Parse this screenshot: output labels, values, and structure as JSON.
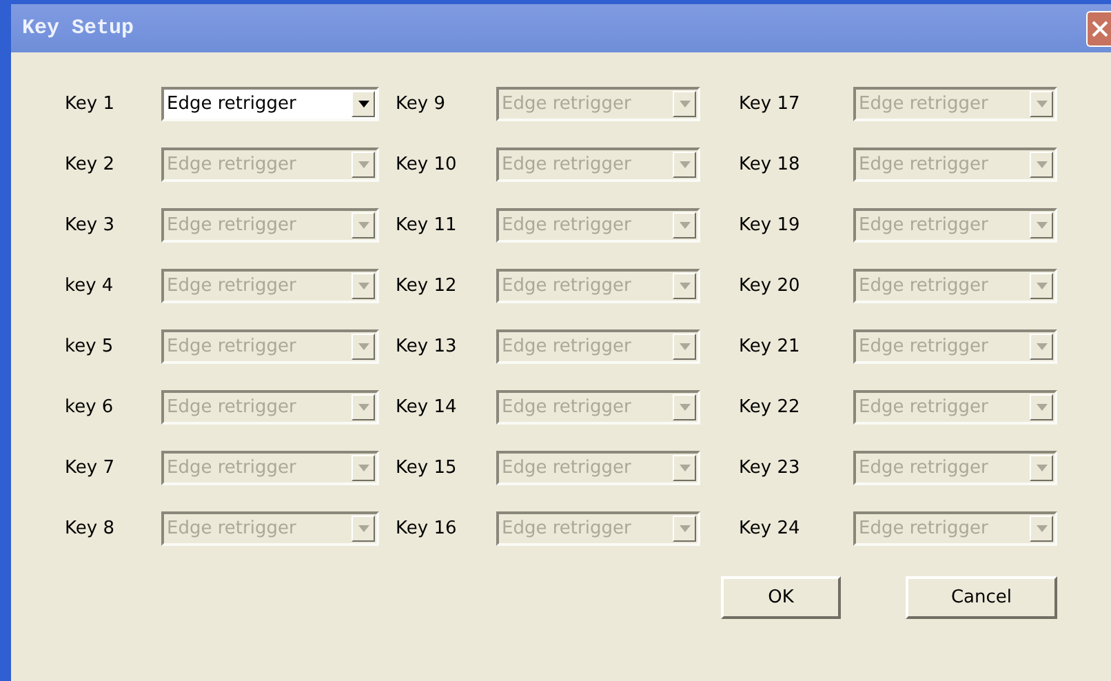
{
  "window": {
    "title": "Key Setup"
  },
  "columns": [
    [
      {
        "label": "Key 1",
        "value": "Edge retrigger",
        "disabled": false
      },
      {
        "label": "Key 2",
        "value": "Edge retrigger",
        "disabled": true
      },
      {
        "label": "Key 3",
        "value": "Edge retrigger",
        "disabled": true
      },
      {
        "label": "key 4",
        "value": "Edge retrigger",
        "disabled": true
      },
      {
        "label": "key 5",
        "value": "Edge retrigger",
        "disabled": true
      },
      {
        "label": "key 6",
        "value": "Edge retrigger",
        "disabled": true
      },
      {
        "label": "Key 7",
        "value": "Edge retrigger",
        "disabled": true
      },
      {
        "label": "Key 8",
        "value": "Edge retrigger",
        "disabled": true
      }
    ],
    [
      {
        "label": "Key 9",
        "value": "Edge retrigger",
        "disabled": true
      },
      {
        "label": "Key 10",
        "value": "Edge retrigger",
        "disabled": true
      },
      {
        "label": "Key 11",
        "value": "Edge retrigger",
        "disabled": true
      },
      {
        "label": "Key 12",
        "value": "Edge retrigger",
        "disabled": true
      },
      {
        "label": "Key 13",
        "value": "Edge retrigger",
        "disabled": true
      },
      {
        "label": "Key 14",
        "value": "Edge retrigger",
        "disabled": true
      },
      {
        "label": "Key 15",
        "value": "Edge retrigger",
        "disabled": true
      },
      {
        "label": "Key 16",
        "value": "Edge retrigger",
        "disabled": true
      }
    ],
    [
      {
        "label": "Key 17",
        "value": "Edge retrigger",
        "disabled": true
      },
      {
        "label": "Key 18",
        "value": "Edge retrigger",
        "disabled": true
      },
      {
        "label": "Key 19",
        "value": "Edge retrigger",
        "disabled": true
      },
      {
        "label": "Key 20",
        "value": "Edge retrigger",
        "disabled": true
      },
      {
        "label": "Key 21",
        "value": "Edge retrigger",
        "disabled": true
      },
      {
        "label": "Key 22",
        "value": "Edge retrigger",
        "disabled": true
      },
      {
        "label": "Key 23",
        "value": "Edge retrigger",
        "disabled": true
      },
      {
        "label": "Key 24",
        "value": "Edge retrigger",
        "disabled": true
      }
    ]
  ],
  "buttons": [
    "OK",
    "Cancel"
  ]
}
